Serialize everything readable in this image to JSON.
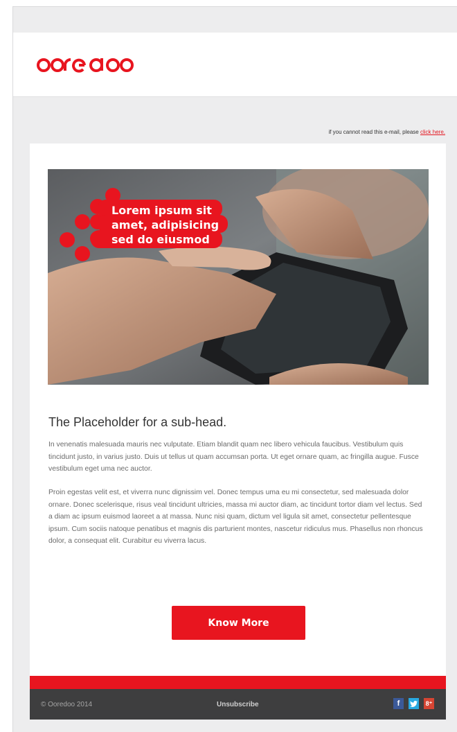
{
  "header": {
    "logo_text": "ooredoo",
    "notice_prefix": "if you cannot read this e-mail, please",
    "notice_link": "click here."
  },
  "hero": {
    "overlay_lines": [
      "Lorem ipsum  sit",
      "amet, adipisicing",
      "sed do eiusmod"
    ],
    "brand_color": "#e8151f"
  },
  "content": {
    "subhead": "The Placeholder for a sub-head.",
    "paragraph1": "In venenatis malesuada mauris nec vulputate. Etiam blandit quam nec libero vehicula faucibus. Vestibulum quis tincidunt justo, in varius justo. Duis ut tellus ut quam accumsan porta. Ut eget ornare quam, ac fringilla augue. Fusce vestibulum eget uma nec auctor.",
    "paragraph2": "Proin egestas velit est, et viverra nunc dignissim vel. Donec tempus uma eu mi consectetur, sed malesuada dolor ornare. Donec scelerisque, risus veal tincidunt ultricies, massa mi auctor diam, ac tincidunt tortor diam vel lectus. Sed a diam ac ipsum euismod laoreet a at massa. Nunc nisi quam, dictum vel ligula sit amet, consectetur pellentesque ipsum. Cum sociis natoque penatibus et magnis dis parturient montes, nascetur ridiculus mus. Phasellus non rhoncus dolor, a consequat elit. Curabitur eu viverra lacus.",
    "cta_label": "Know More"
  },
  "footer": {
    "copyright": "© Ooredoo 2014",
    "unsubscribe": "Unsubscribe",
    "social": {
      "facebook": "f",
      "twitter": "t",
      "googleplus": "8⁺"
    }
  },
  "colors": {
    "brand_red": "#e8151f",
    "footer_bg": "#3e3e3f",
    "page_bg": "#ededee"
  }
}
